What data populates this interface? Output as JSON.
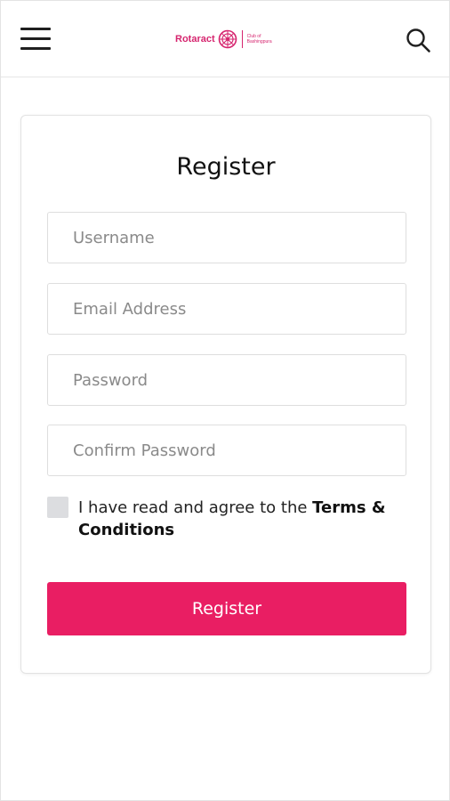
{
  "header": {
    "menu_icon": "hamburger-menu-icon",
    "logo": {
      "word": "Rotaract",
      "sub_line1": "Club of",
      "sub_line2": "Bashingpura",
      "color": "#d6256f"
    },
    "search_icon": "search-icon"
  },
  "form": {
    "title": "Register",
    "fields": {
      "username": {
        "placeholder": "Username",
        "value": ""
      },
      "email": {
        "placeholder": "Email Address",
        "value": ""
      },
      "password": {
        "placeholder": "Password",
        "value": ""
      },
      "confirm_password": {
        "placeholder": "Confirm Password",
        "value": ""
      }
    },
    "agree": {
      "checked": false,
      "text": "I have read and agree to the ",
      "link_text": "Terms & Conditions"
    },
    "submit_label": "Register"
  },
  "colors": {
    "accent": "#e91e63",
    "checkbox_bg": "#dcdde0",
    "border": "#dedede"
  }
}
